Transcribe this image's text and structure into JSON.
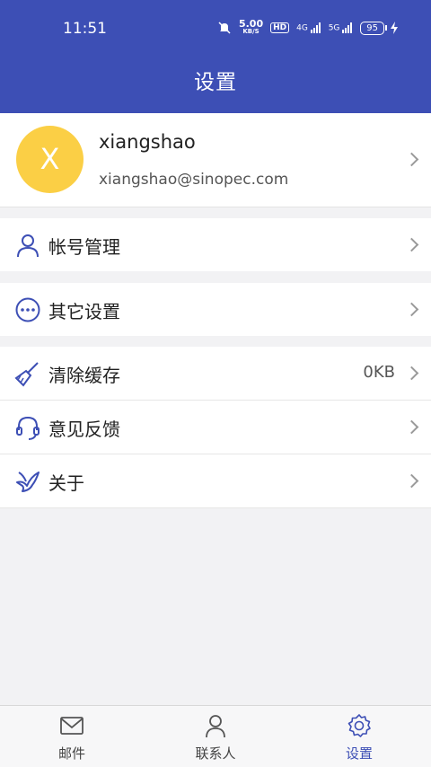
{
  "status_bar": {
    "time": "11:51",
    "net_speed_value": "5.00",
    "net_speed_unit": "KB/S",
    "hd": "HD",
    "signal_1": "4G",
    "signal_2": "5G",
    "battery": "95"
  },
  "header": {
    "title": "设置"
  },
  "profile": {
    "avatar_letter": "X",
    "name": "xiangshao",
    "email": "xiangshao@sinopec.com"
  },
  "settings": {
    "account": {
      "label": "帐号管理",
      "icon": "person-icon"
    },
    "other": {
      "label": "其它设置",
      "icon": "more-icon"
    },
    "cache": {
      "label": "清除缓存",
      "value": "0KB",
      "icon": "broom-icon"
    },
    "feedback": {
      "label": "意见反馈",
      "icon": "headset-icon"
    },
    "about": {
      "label": "关于",
      "icon": "dove-icon"
    }
  },
  "tabs": [
    {
      "label": "邮件",
      "icon": "mail-icon"
    },
    {
      "label": "联系人",
      "icon": "contact-icon"
    },
    {
      "label": "设置",
      "icon": "gear-icon",
      "active": true
    }
  ],
  "colors": {
    "primary": "#3d4fb5",
    "avatar": "#fbcf45",
    "background": "#f2f2f4"
  }
}
